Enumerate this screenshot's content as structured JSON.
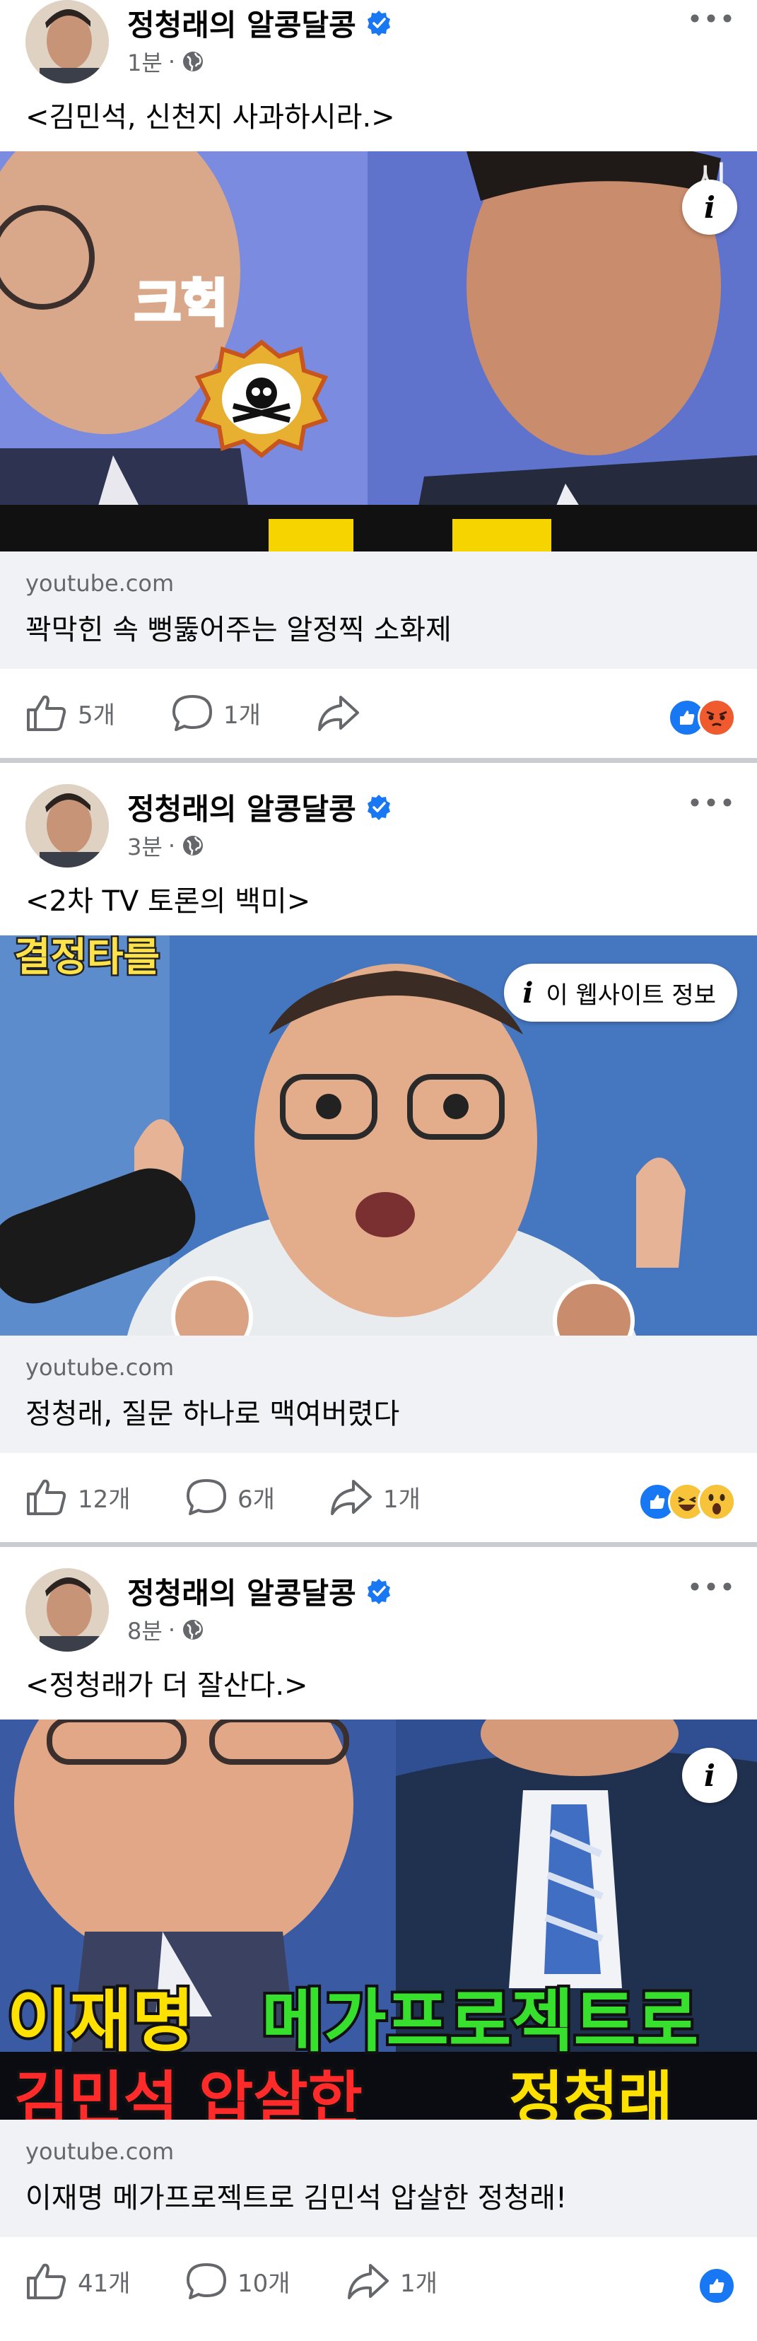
{
  "colors": {
    "accent": "#1877f2",
    "meta": "#65676b",
    "link_bg": "#f0f2f5",
    "divider": "#c9ccd1"
  },
  "posts": [
    {
      "author": "정청래의 알콩달콩",
      "time": "1분",
      "text": "<김민석, 신천지 사과하시라.>",
      "thumb_overlay_text": "크헉",
      "thumb_info": "icon",
      "domain": "youtube.com",
      "link_title": "꽉막힌 속 뻥뚫어주는 알정찍 소화제",
      "likes": "5개",
      "comments": "1개",
      "shares": "",
      "reactions": [
        "like",
        "angry"
      ]
    },
    {
      "author": "정청래의 알콩달콩",
      "time": "3분",
      "text": "<2차 TV 토론의 백미>",
      "thumb_overlay_text": "결정타를",
      "thumb_info": "이 웹사이트 정보",
      "domain": "youtube.com",
      "link_title": "정청래, 질문 하나로 맥여버렸다",
      "likes": "12개",
      "comments": "6개",
      "shares": "1개",
      "reactions": [
        "like",
        "haha",
        "wow"
      ]
    },
    {
      "author": "정청래의 알콩달콩",
      "time": "8분",
      "text": "<정청래가 더 잘산다.>",
      "thumb_overlay_line1_a": "이재명",
      "thumb_overlay_line1_b": "메가프로젝트로",
      "thumb_overlay_line2_a": "김민석 압살한",
      "thumb_overlay_line2_b": "정청래",
      "thumb_info": "icon",
      "domain": "youtube.com",
      "link_title": "이재명 메가프로젝트로 김민석 압살한 정청래!",
      "likes": "41개",
      "comments": "10개",
      "shares": "1개",
      "reactions": [
        "like"
      ]
    }
  ]
}
